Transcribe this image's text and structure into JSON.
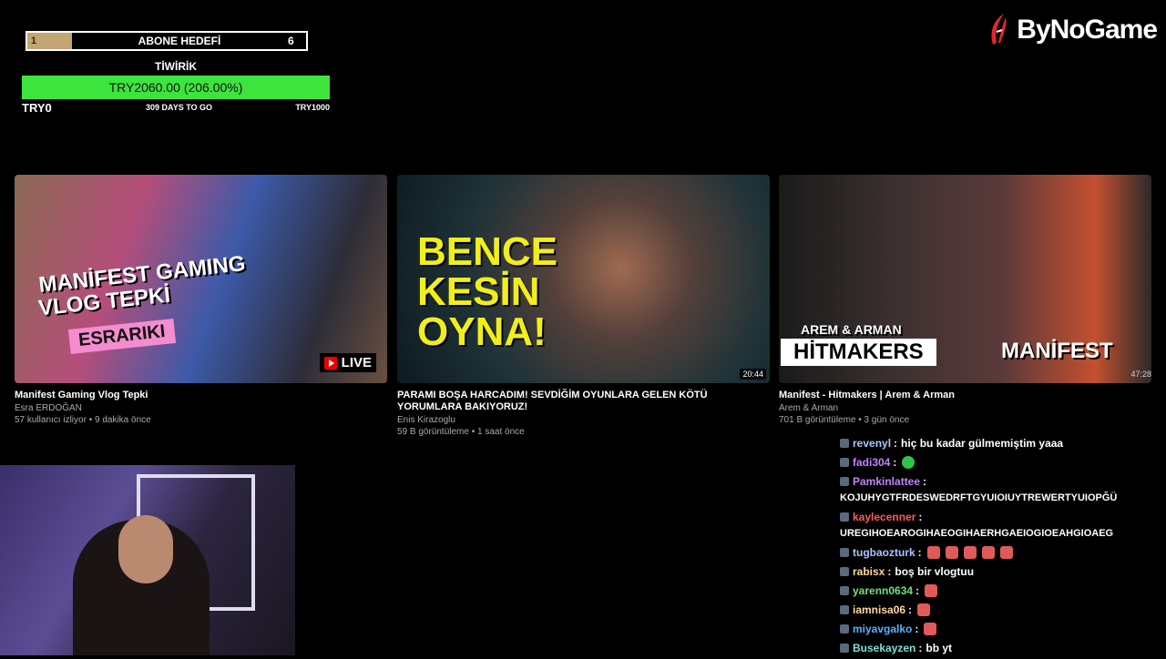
{
  "sub_goal": {
    "start": "1",
    "title": "ABONE HEDEFİ",
    "end": "6",
    "progress": 0.16
  },
  "donation": {
    "title": "TİWİRİK",
    "amount_text": "TRY2060.00 (206.00%)",
    "progress_pct": 206,
    "min": "TRY0",
    "days": "309 DAYS TO GO",
    "max": "TRY1000",
    "bar_color": "#3ee43e"
  },
  "logo": {
    "text": "ByNoGame",
    "icon": "bynogame-feather-icon",
    "color": "#e0282c"
  },
  "videos": [
    {
      "title": "Manifest Gaming Vlog Tepki",
      "channel": "Esra ERDOĞAN",
      "meta": "57 kullanıcı izliyor • 9 dakika önce",
      "badge": "LIVE",
      "overlay": {
        "line1": "MANİFEST GAMING",
        "line2": "VLOG TEPKİ",
        "tag": "ESRARIKI"
      }
    },
    {
      "title": "PARAMI BOŞA HARCADIM! SEVDİĞİM OYUNLARA GELEN KÖTÜ YORUMLARA BAKIYORUZ!",
      "channel": "Enis Kirazoglu",
      "meta": "59 B görüntüleme • 1 saat önce",
      "duration": "20:44",
      "overlay": {
        "line1": "BENCE",
        "line2": "KESİN",
        "line3": "OYNA!"
      }
    },
    {
      "title": "Manifest - Hitmakers | Arem & Arman",
      "channel": "Arem & Arman",
      "meta": "701 B görüntüleme • 3 gün önce",
      "duration": "47:28",
      "overlay": {
        "line1": "AREM & ARMAN",
        "line2": "HİTMAKERS",
        "brand": "MANİFEST"
      }
    }
  ],
  "chat": [
    {
      "user": "revenyl",
      "color": "#a9c6ff",
      "text": "hiç bu kadar gülmemiştim yaaa",
      "emotes": []
    },
    {
      "user": "fadi304",
      "color": "#c084fc",
      "text": "",
      "emotes": [
        "green"
      ]
    },
    {
      "user": "Pamkinlattee",
      "color": "#c084fc",
      "text": "KOJUHYGTFRDESWEDRFTGYUIOIUYTREWERTYUIOPĞÜ",
      "emotes": [],
      "wrap": true
    },
    {
      "user": "kaylecenner",
      "color": "#ff5a5a",
      "text": "UREGIHOEAROGIHAEOGIHAERHGAEIOGIOEAHGIOAEG",
      "emotes": [],
      "wrap": true
    },
    {
      "user": "tugbaozturk",
      "color": "#a9c6ff",
      "text": "",
      "emotes": [
        "red",
        "red",
        "red",
        "red",
        "red"
      ]
    },
    {
      "user": "rabisx",
      "color": "#ffd6a0",
      "text": "boş bir vlogtuu",
      "emotes": []
    },
    {
      "user": "yarenn0634",
      "color": "#6ee07a",
      "text": "",
      "emotes": [
        "red"
      ]
    },
    {
      "user": "iamnisa06",
      "color": "#ffd6a0",
      "text": "",
      "emotes": [
        "red"
      ]
    },
    {
      "user": "miyavgalko",
      "color": "#5ab0ff",
      "text": "",
      "emotes": [
        "red"
      ]
    },
    {
      "user": "Busekayzen",
      "color": "#7fe0d8",
      "text": "bb yt",
      "emotes": []
    }
  ]
}
